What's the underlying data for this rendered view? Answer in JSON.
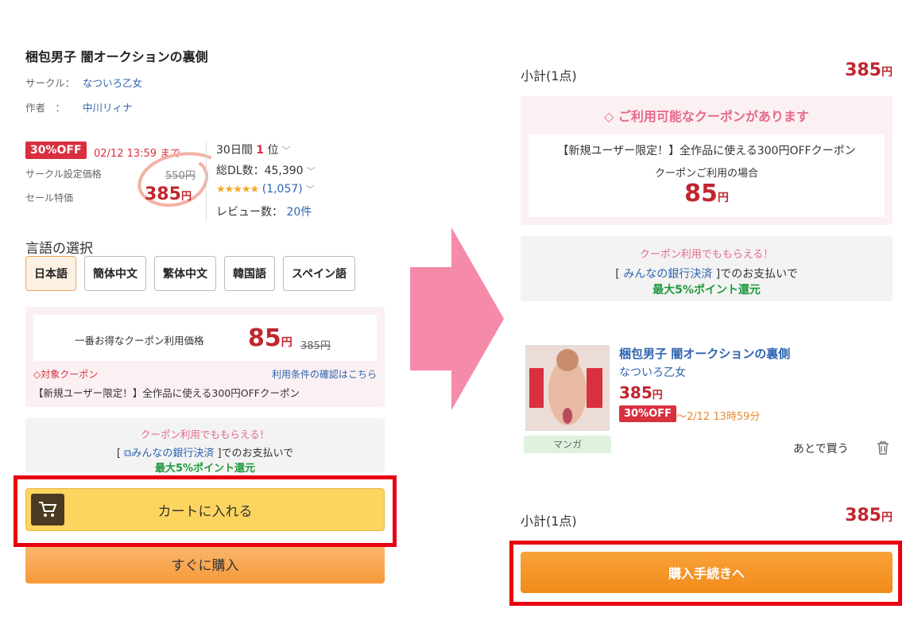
{
  "product": {
    "title": "梱包男子 闇オークションの裏側",
    "circle_label": "サークル：",
    "circle_value": "なついろ乙女",
    "author_label": "作者　：",
    "author_value": "中川リィナ"
  },
  "pricing": {
    "off_badge": "30%OFF",
    "off_until": "02/12 13:59 まで",
    "circle_price_label": "サークル設定価格",
    "circle_price": "550円",
    "sale_label": "セール特価",
    "sale_price": "385",
    "yen": "円"
  },
  "stats": {
    "rank_prefix": "30日間",
    "rank_value": "1",
    "rank_suffix": "位",
    "downloads": "総DL数：45,390",
    "stars": "★★★★★",
    "rating_count": "(1,057)",
    "review_label": "レビュー数：",
    "review_count": "20件"
  },
  "language": {
    "title": "言語の選択",
    "options": [
      "日本語",
      "簡体中文",
      "繁体中文",
      "韓国語",
      "スペイン語"
    ]
  },
  "coupon_box": {
    "label": "一番お得なクーポン利用価格",
    "price": "85",
    "yen": "円",
    "old_price": "385円",
    "target": "対象クーポン",
    "terms": "利用条件の確認はこちら",
    "desc": "【新規ユーザー限定！】全作品に使える300円OFFクーポン"
  },
  "bank": {
    "l1": "クーポン利用でももらえる！",
    "l2_prefix": "[",
    "l2_link": "みんなの銀行決済",
    "l2_suffix": "]でのお支払いで",
    "l3": "最大5%ポイント還元"
  },
  "buttons": {
    "cart": "カートに入れる",
    "buy_now": "すぐに購入",
    "checkout": "購入手続きへ"
  },
  "cart": {
    "subtotal_label": "小計(1点)",
    "subtotal_value": "385",
    "yen": "円",
    "coupon_head": "ご利用可能なクーポンがあります",
    "coupon_desc": "【新規ユーザー限定！】全作品に使える300円OFFクーポン",
    "coupon_when": "クーポンご利用の場合",
    "coupon_price": "85",
    "item": {
      "title": "梱包男子 闇オークションの裏側",
      "circle": "なついろ乙女",
      "price": "385",
      "off": "30%OFF",
      "until": "～2/12 13時59分",
      "tag": "マンガ",
      "later": "あとで買う"
    }
  },
  "colors": {
    "accent_red": "#c0262f",
    "frame_red": "#e60012",
    "arrow_pink": "#f58aa9",
    "orange": "#f18b1b"
  }
}
